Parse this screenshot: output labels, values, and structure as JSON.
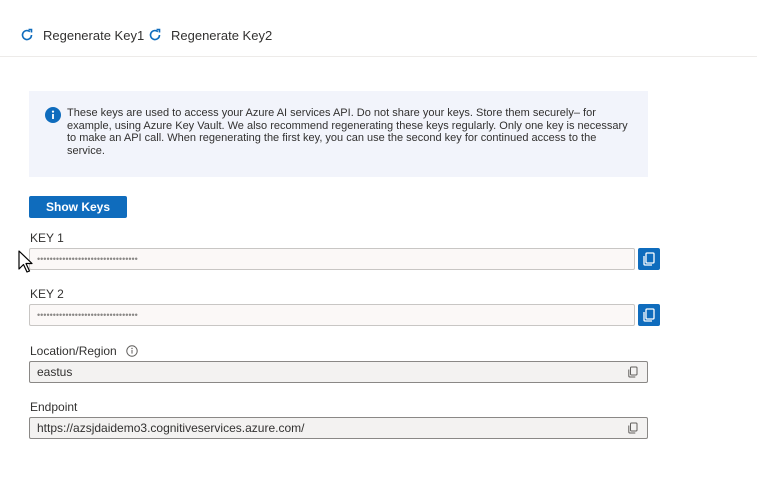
{
  "toolbar": {
    "regen1_label": "Regenerate Key1",
    "regen2_label": "Regenerate Key2",
    "icon": "refresh-icon"
  },
  "info": {
    "icon": "info-icon",
    "message": "These keys are used to access your Azure AI services API. Do not share your keys. Store them securely– for example, using Azure Key Vault. We also recommend regenerating these keys regularly. Only one key is necessary to make an API call. When regenerating the first key, you can use the second key for continued access to the service."
  },
  "show_keys_label": "Show Keys",
  "key1": {
    "label": "KEY 1",
    "value": "••••••••••••••••••••••••••••••••"
  },
  "key2": {
    "label": "KEY 2",
    "value": "••••••••••••••••••••••••••••••••"
  },
  "location": {
    "label": "Location/Region",
    "value": "eastus"
  },
  "endpoint": {
    "label": "Endpoint",
    "value": "https://azsjdaidemo3.cognitiveservices.azure.com/"
  },
  "colors": {
    "accent": "#0f6cbd",
    "info_bg": "#f2f4fb"
  }
}
